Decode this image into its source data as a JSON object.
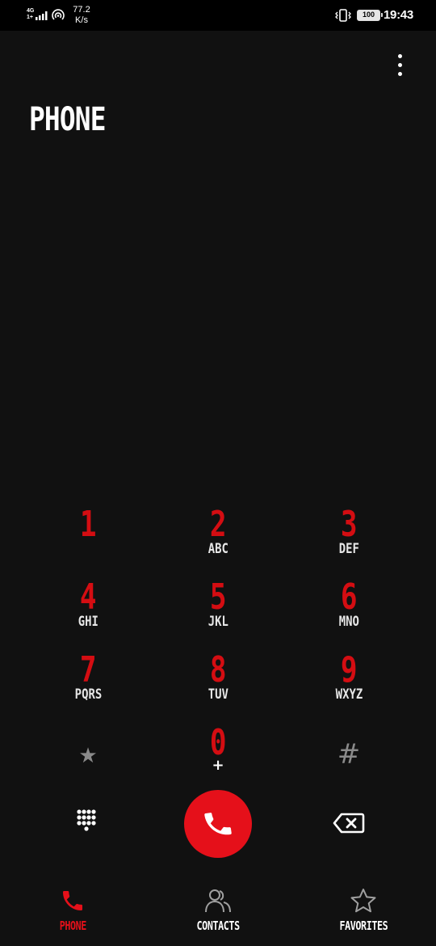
{
  "status_bar": {
    "network_type": "4G",
    "network_sub": "1+",
    "speed_value": "77.2",
    "speed_unit": "K/s",
    "battery": "100",
    "time": "19:43"
  },
  "header": {
    "title": "PHONE",
    "more_icon": "more-vert-icon"
  },
  "dialpad": {
    "keys": [
      {
        "digit": "1",
        "letters": ""
      },
      {
        "digit": "2",
        "letters": "ABC"
      },
      {
        "digit": "3",
        "letters": "DEF"
      },
      {
        "digit": "4",
        "letters": "GHI"
      },
      {
        "digit": "5",
        "letters": "JKL"
      },
      {
        "digit": "6",
        "letters": "MNO"
      },
      {
        "digit": "7",
        "letters": "PQRS"
      },
      {
        "digit": "8",
        "letters": "TUV"
      },
      {
        "digit": "9",
        "letters": "WXYZ"
      },
      {
        "digit": "★",
        "letters": ""
      },
      {
        "digit": "0",
        "letters": "+"
      },
      {
        "digit": "#",
        "letters": ""
      }
    ]
  },
  "actions": {
    "dialpad_icon": "dialpad-icon",
    "call_icon": "phone-icon",
    "backspace_icon": "backspace-icon"
  },
  "bottom_nav": {
    "items": [
      {
        "label": "PHONE",
        "icon": "phone-icon",
        "active": true
      },
      {
        "label": "CONTACTS",
        "icon": "contacts-icon",
        "active": false
      },
      {
        "label": "FAVORITES",
        "icon": "star-icon",
        "active": false
      }
    ]
  },
  "colors": {
    "accent": "#e5101a",
    "digit": "#d40d12",
    "background": "#111111"
  }
}
